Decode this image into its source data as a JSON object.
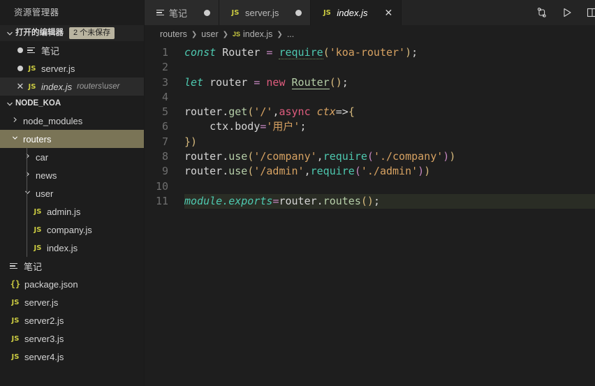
{
  "sidebar": {
    "title": "资源管理器",
    "open_editors": {
      "label": "打开的编辑器",
      "badge": "2 个未保存",
      "twisty": "chevron-down",
      "items": [
        {
          "state": "dirty",
          "icon": "notes-icon",
          "name": "笔记",
          "path": "",
          "italic": false,
          "selected": false
        },
        {
          "state": "dirty",
          "icon": "js-icon",
          "name": "server.js",
          "path": "",
          "italic": false,
          "selected": false
        },
        {
          "state": "close",
          "icon": "js-icon",
          "name": "index.js",
          "path": "routers\\user",
          "italic": true,
          "selected": true
        }
      ]
    },
    "project": {
      "label": "NODE_KOA",
      "twisty": "chevron-down",
      "tree": [
        {
          "depth": 1,
          "kind": "folder",
          "chevron": "chevron-right",
          "name": "node_modules",
          "selected": false
        },
        {
          "depth": 1,
          "kind": "folder",
          "chevron": "chevron-down",
          "name": "routers",
          "selected": true
        },
        {
          "depth": 2,
          "kind": "folder",
          "chevron": "chevron-right",
          "name": "car",
          "selected": false
        },
        {
          "depth": 2,
          "kind": "folder",
          "chevron": "chevron-right",
          "name": "news",
          "selected": false
        },
        {
          "depth": 2,
          "kind": "folder",
          "chevron": "chevron-down",
          "name": "user",
          "selected": false
        },
        {
          "depth": 3,
          "kind": "js",
          "chevron": "",
          "name": "admin.js",
          "selected": false
        },
        {
          "depth": 3,
          "kind": "js",
          "chevron": "",
          "name": "company.js",
          "selected": false
        },
        {
          "depth": 3,
          "kind": "js",
          "chevron": "",
          "name": "index.js",
          "selected": false
        },
        {
          "depth": 1,
          "kind": "notes",
          "chevron": "",
          "name": "笔记",
          "selected": false
        },
        {
          "depth": 1,
          "kind": "json",
          "chevron": "",
          "name": "package.json",
          "selected": false
        },
        {
          "depth": 1,
          "kind": "js",
          "chevron": "",
          "name": "server.js",
          "selected": false
        },
        {
          "depth": 1,
          "kind": "js",
          "chevron": "",
          "name": "server2.js",
          "selected": false
        },
        {
          "depth": 1,
          "kind": "js",
          "chevron": "",
          "name": "server3.js",
          "selected": false
        },
        {
          "depth": 1,
          "kind": "js",
          "chevron": "",
          "name": "server4.js",
          "selected": false
        }
      ]
    }
  },
  "tabs": [
    {
      "icon": "notes-icon",
      "label": "笔记",
      "status": "dirty",
      "active": false,
      "italic": false
    },
    {
      "icon": "js-icon",
      "label": "server.js",
      "status": "dirty",
      "active": false,
      "italic": false
    },
    {
      "icon": "js-icon",
      "label": "index.js",
      "status": "close",
      "active": true,
      "italic": true
    }
  ],
  "tab_actions": [
    {
      "name": "compare-changes-icon",
      "glyph": "compare"
    },
    {
      "name": "run-play-icon",
      "glyph": "play"
    },
    {
      "name": "split-editor-icon",
      "glyph": "split"
    }
  ],
  "breadcrumb": {
    "items": [
      "routers",
      "user",
      "index.js",
      "..."
    ],
    "file_icon": "js-icon",
    "separator": "›"
  },
  "editor": {
    "line_numbers": [
      "1",
      "2",
      "3",
      "4",
      "5",
      "6",
      "7",
      "8",
      "9",
      "10",
      "11"
    ],
    "current_line": 11,
    "lines": [
      {
        "n": 1,
        "tokens": [
          {
            "t": "const",
            "c": "t-kw"
          },
          {
            "t": " ",
            "c": "t-plain"
          },
          {
            "t": "Router",
            "c": "t-plain"
          },
          {
            "t": " ",
            "c": "t-plain"
          },
          {
            "t": "=",
            "c": "t-op"
          },
          {
            "t": " ",
            "c": "t-plain"
          },
          {
            "t": "require",
            "c": "t-req"
          },
          {
            "t": "(",
            "c": "t-paren"
          },
          {
            "t": "'koa-router'",
            "c": "t-str"
          },
          {
            "t": ")",
            "c": "t-paren"
          },
          {
            "t": ";",
            "c": "t-plain"
          }
        ]
      },
      {
        "n": 2,
        "tokens": []
      },
      {
        "n": 3,
        "tokens": [
          {
            "t": "let",
            "c": "t-kw"
          },
          {
            "t": " ",
            "c": "t-plain"
          },
          {
            "t": "router",
            "c": "t-plain"
          },
          {
            "t": " ",
            "c": "t-plain"
          },
          {
            "t": "=",
            "c": "t-op"
          },
          {
            "t": " ",
            "c": "t-plain"
          },
          {
            "t": "new",
            "c": "t-new"
          },
          {
            "t": " ",
            "c": "t-plain"
          },
          {
            "t": "Router",
            "c": "t-type"
          },
          {
            "t": "()",
            "c": "t-paren"
          },
          {
            "t": ";",
            "c": "t-plain"
          }
        ]
      },
      {
        "n": 4,
        "tokens": []
      },
      {
        "n": 5,
        "tokens": [
          {
            "t": "router",
            "c": "t-plain"
          },
          {
            "t": ".",
            "c": "t-plain"
          },
          {
            "t": "get",
            "c": "t-method"
          },
          {
            "t": "(",
            "c": "t-paren"
          },
          {
            "t": "'/'",
            "c": "t-str"
          },
          {
            "t": ",",
            "c": "t-plain"
          },
          {
            "t": "async",
            "c": "t-async"
          },
          {
            "t": " ",
            "c": "t-plain"
          },
          {
            "t": "ctx",
            "c": "t-param"
          },
          {
            "t": "=>",
            "c": "t-plain"
          },
          {
            "t": "{",
            "c": "t-brace"
          }
        ]
      },
      {
        "n": 6,
        "tokens": [
          {
            "t": "    ",
            "c": "t-plain"
          },
          {
            "t": "ctx",
            "c": "t-plain"
          },
          {
            "t": ".",
            "c": "t-plain"
          },
          {
            "t": "body",
            "c": "t-plain"
          },
          {
            "t": "=",
            "c": "t-op"
          },
          {
            "t": "'用户'",
            "c": "t-str"
          },
          {
            "t": ";",
            "c": "t-plain"
          }
        ]
      },
      {
        "n": 7,
        "tokens": [
          {
            "t": "}",
            "c": "t-brace"
          },
          {
            "t": ")",
            "c": "t-paren"
          }
        ]
      },
      {
        "n": 8,
        "tokens": [
          {
            "t": "router",
            "c": "t-plain"
          },
          {
            "t": ".",
            "c": "t-plain"
          },
          {
            "t": "use",
            "c": "t-method"
          },
          {
            "t": "(",
            "c": "t-paren"
          },
          {
            "t": "'/company'",
            "c": "t-str"
          },
          {
            "t": ",",
            "c": "t-plain"
          },
          {
            "t": "require",
            "c": "t-req2"
          },
          {
            "t": "(",
            "c": "t-brace2"
          },
          {
            "t": "'./company'",
            "c": "t-str"
          },
          {
            "t": ")",
            "c": "t-brace2"
          },
          {
            "t": ")",
            "c": "t-paren"
          }
        ]
      },
      {
        "n": 9,
        "tokens": [
          {
            "t": "router",
            "c": "t-plain"
          },
          {
            "t": ".",
            "c": "t-plain"
          },
          {
            "t": "use",
            "c": "t-method"
          },
          {
            "t": "(",
            "c": "t-paren"
          },
          {
            "t": "'/admin'",
            "c": "t-str"
          },
          {
            "t": ",",
            "c": "t-plain"
          },
          {
            "t": "require",
            "c": "t-req2"
          },
          {
            "t": "(",
            "c": "t-brace2"
          },
          {
            "t": "'./admin'",
            "c": "t-str"
          },
          {
            "t": ")",
            "c": "t-brace2"
          },
          {
            "t": ")",
            "c": "t-paren"
          }
        ]
      },
      {
        "n": 10,
        "tokens": []
      },
      {
        "n": 11,
        "tokens": [
          {
            "t": "module",
            "c": "t-mod"
          },
          {
            "t": ".",
            "c": "t-mod"
          },
          {
            "t": "exports",
            "c": "t-mod"
          },
          {
            "t": "=",
            "c": "t-op"
          },
          {
            "t": "router",
            "c": "t-plain"
          },
          {
            "t": ".",
            "c": "t-plain"
          },
          {
            "t": "routes",
            "c": "t-method"
          },
          {
            "t": "()",
            "c": "t-paren"
          },
          {
            "t": ";",
            "c": "t-plain"
          }
        ]
      }
    ]
  },
  "colors": {
    "editor_bg": "#1e1e1e",
    "sidebar_bg": "#1d1d1d",
    "tabbar_bg": "#242424",
    "selection_olive": "#7a7456",
    "badge_bg": "#b9b4a0",
    "js_icon": "#cbcb41"
  }
}
